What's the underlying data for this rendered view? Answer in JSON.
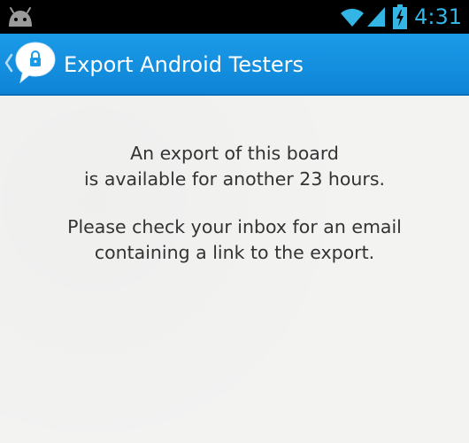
{
  "status_bar": {
    "time": "4:31",
    "icons": [
      "android-icon",
      "wifi-icon",
      "signal-icon",
      "battery-charging-icon"
    ],
    "clock_color": "#33b5e5"
  },
  "action_bar": {
    "title": "Export Android Testers",
    "logo_icon": "speech-bubble-lock-icon",
    "up_icon": "chevron-left-icon",
    "background_color": "#1a9be8"
  },
  "content": {
    "paragraph1": {
      "line1": "An export of this board",
      "line2": "is available for another 23 hours."
    },
    "paragraph2": {
      "line1": "Please check your inbox for an email",
      "line2": "containing a link to the export."
    }
  }
}
